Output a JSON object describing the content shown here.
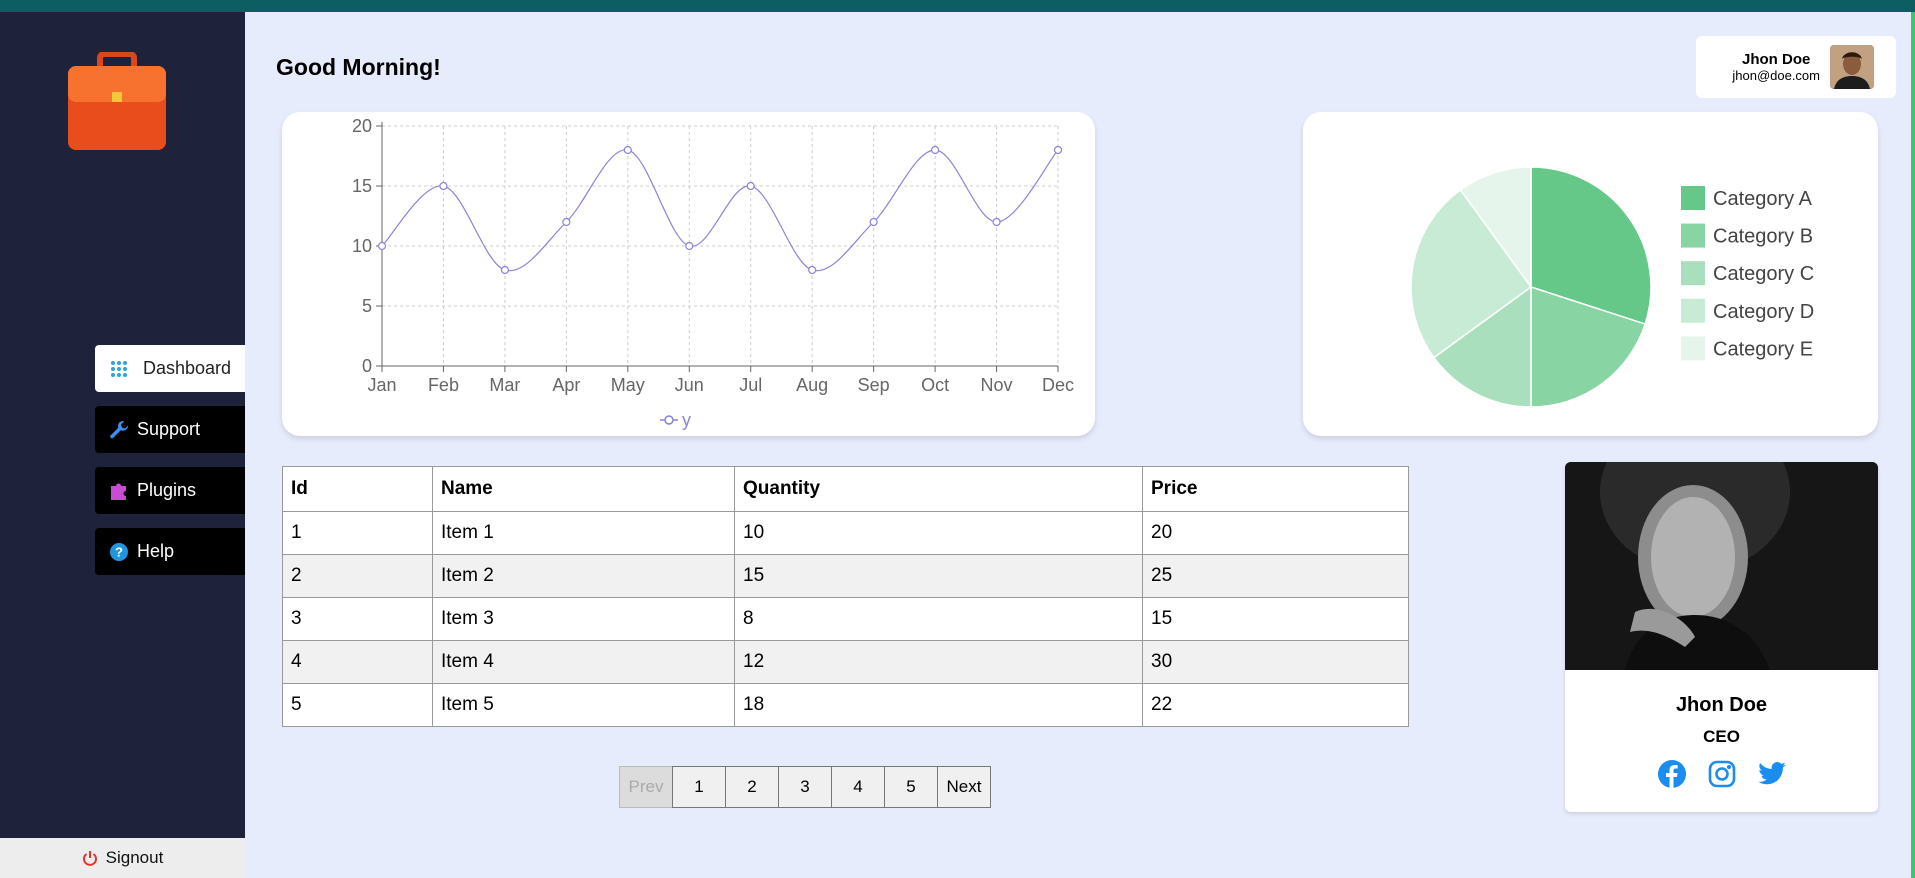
{
  "header": {
    "greeting": "Good Morning!"
  },
  "user": {
    "name": "Jhon Doe",
    "email": "jhon@doe.com"
  },
  "sidebar": {
    "items": [
      {
        "label": "Dashboard",
        "icon": "grid-icon",
        "active": true
      },
      {
        "label": "Support",
        "icon": "wrench-icon"
      },
      {
        "label": "Plugins",
        "icon": "puzzle-icon"
      },
      {
        "label": "Help",
        "icon": "help-icon"
      }
    ],
    "signout": "Signout"
  },
  "chart_data": [
    {
      "type": "line",
      "x": [
        "Jan",
        "Feb",
        "Mar",
        "Apr",
        "May",
        "Jun",
        "Jul",
        "Aug",
        "Sep",
        "Oct",
        "Nov",
        "Dec"
      ],
      "series": [
        {
          "name": "y",
          "values": [
            10,
            15,
            8,
            12,
            18,
            10,
            15,
            8,
            12,
            18,
            12,
            18
          ],
          "color": "#8884d8"
        }
      ],
      "ylim": [
        0,
        20
      ],
      "yticks": [
        0,
        5,
        10,
        15,
        20
      ],
      "grid": true,
      "legend": "bottom"
    },
    {
      "type": "pie",
      "categories": [
        "Category A",
        "Category B",
        "Category C",
        "Category D",
        "Category E"
      ],
      "values": [
        30,
        20,
        15,
        25,
        10
      ],
      "colors": [
        "#66c888",
        "#88d4a2",
        "#a9dfbc",
        "#c8ebd5",
        "#e6f5eb"
      ],
      "legend": "right"
    }
  ],
  "table": {
    "headers": [
      "Id",
      "Name",
      "Quantity",
      "Price"
    ],
    "rows": [
      [
        "1",
        "Item 1",
        "10",
        "20"
      ],
      [
        "2",
        "Item 2",
        "15",
        "25"
      ],
      [
        "3",
        "Item 3",
        "8",
        "15"
      ],
      [
        "4",
        "Item 4",
        "12",
        "30"
      ],
      [
        "5",
        "Item 5",
        "18",
        "22"
      ]
    ]
  },
  "pagination": {
    "prev": "Prev",
    "pages": [
      "1",
      "2",
      "3",
      "4",
      "5"
    ],
    "next": "Next"
  },
  "profile": {
    "name": "Jhon Doe",
    "role": "CEO",
    "socials": [
      "facebook-icon",
      "instagram-icon",
      "twitter-icon"
    ]
  }
}
